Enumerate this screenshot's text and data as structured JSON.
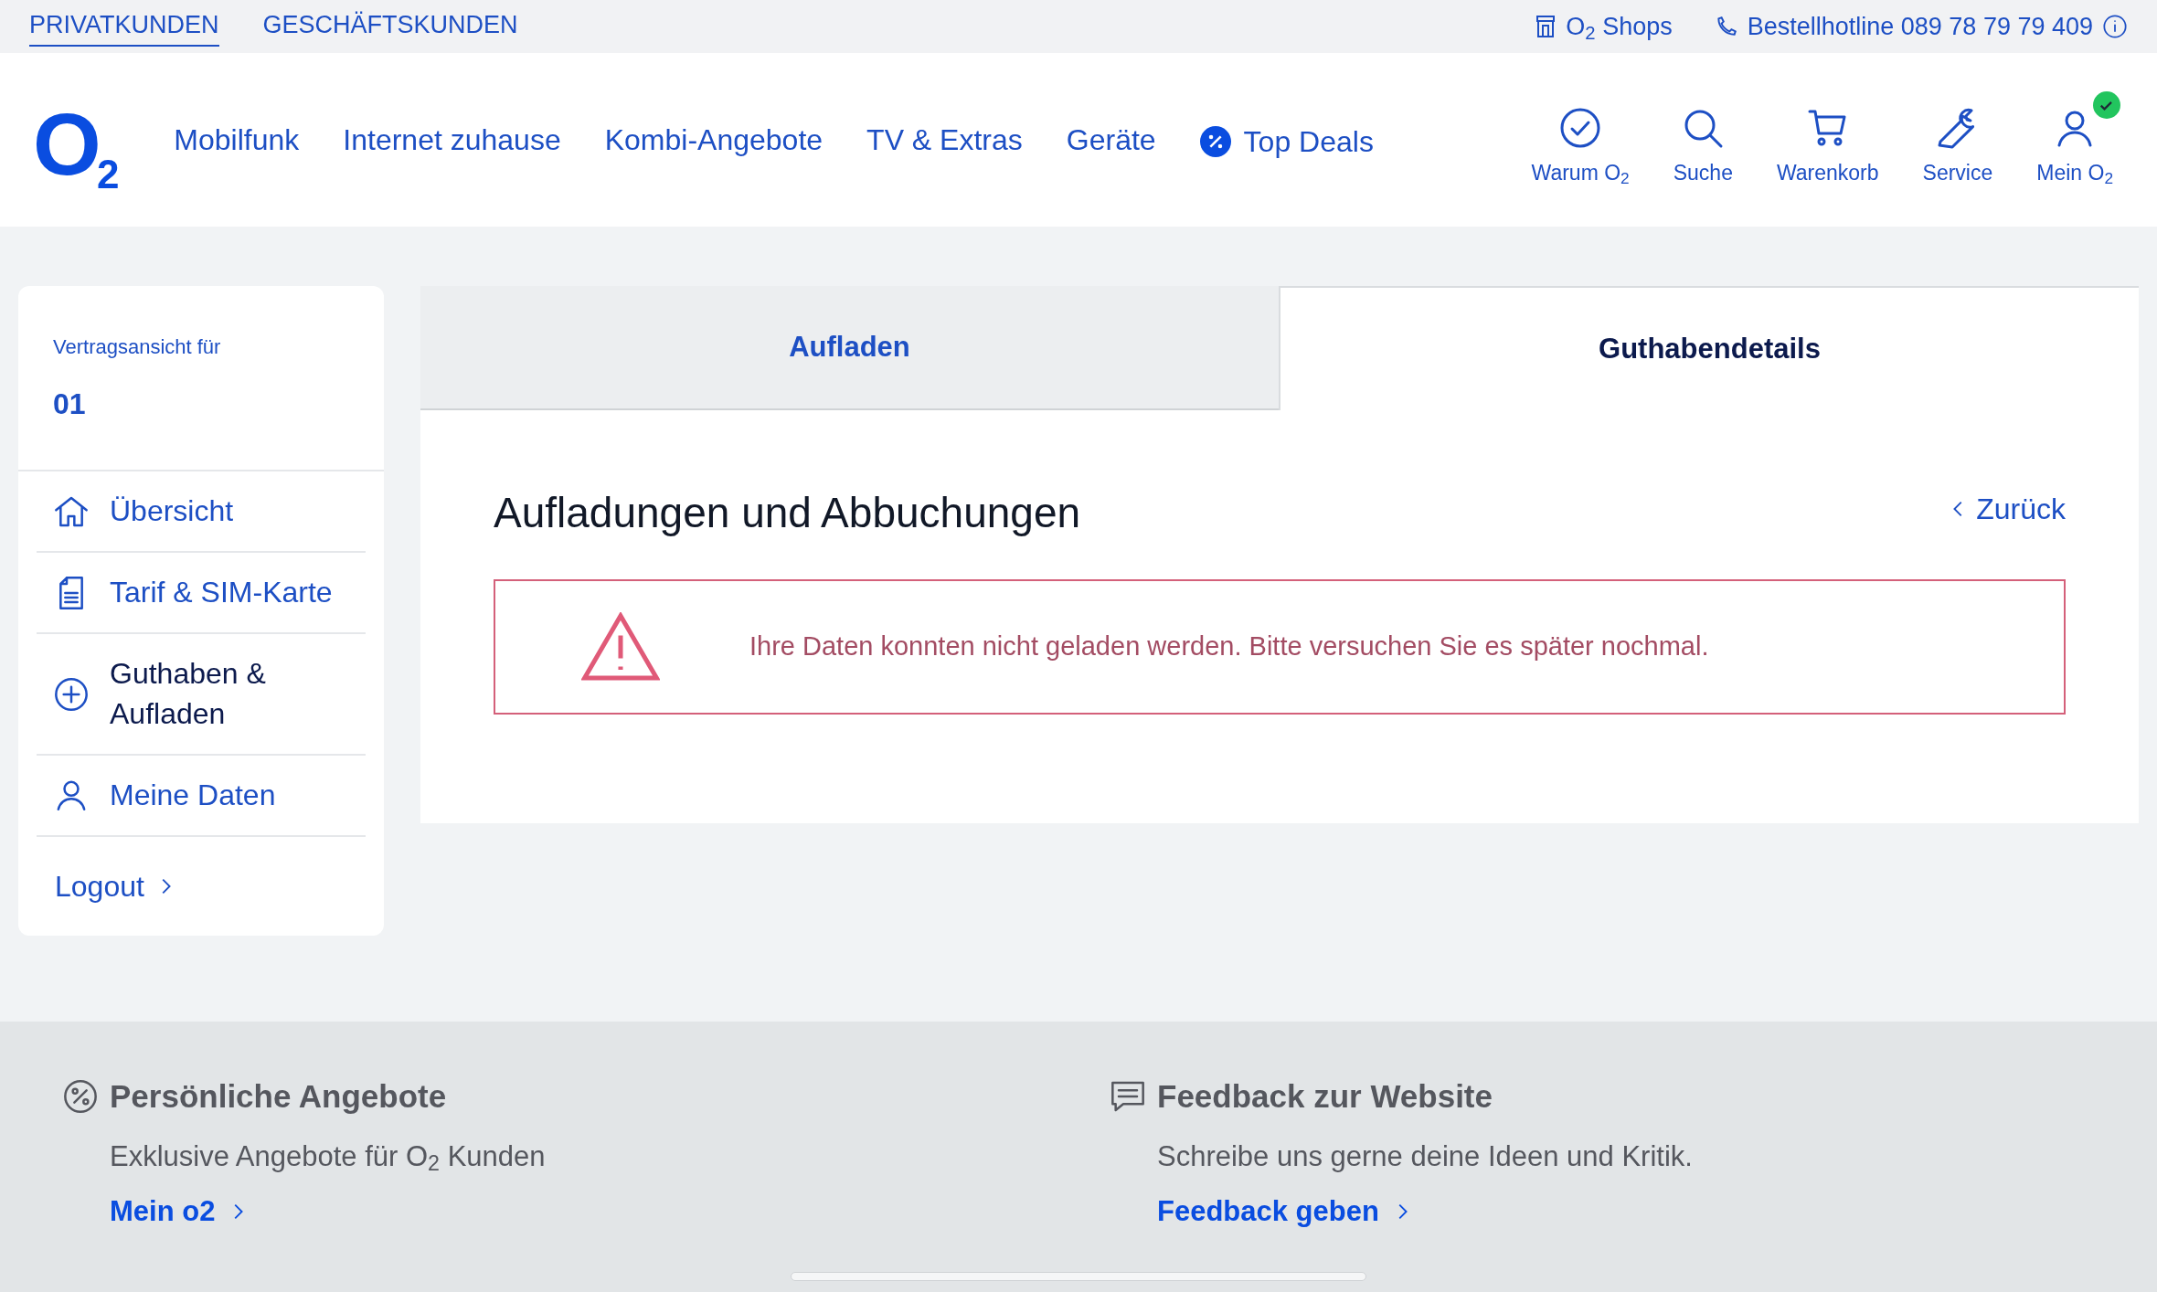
{
  "top_bar": {
    "segments": [
      {
        "label": "PRIVATKUNDEN",
        "selected": true
      },
      {
        "label": "GESCHÄFTSKUNDEN",
        "selected": false
      }
    ],
    "shops": "O$_{2}$ Shops",
    "hotline": "Bestellhotline 089 78 79 79 409"
  },
  "header": {
    "logo": "O",
    "logo_sub": "2",
    "nav": [
      {
        "label": "Mobilfunk",
        "kind": "plain"
      },
      {
        "label": "Internet zuhause",
        "kind": "plain"
      },
      {
        "label": "Kombi-Angebote",
        "kind": "plain"
      },
      {
        "label": "TV & Extras",
        "kind": "plain"
      },
      {
        "label": "Geräte",
        "kind": "plain"
      },
      {
        "label": "Top Deals",
        "kind": "deal"
      }
    ],
    "actions": [
      {
        "label": "Warum O$_{2}$",
        "kind": "check",
        "badge": false
      },
      {
        "label": "Suche",
        "kind": "search",
        "badge": false
      },
      {
        "label": "Warenkorb",
        "kind": "cart",
        "badge": false
      },
      {
        "label": "Service",
        "kind": "wrench",
        "badge": false
      },
      {
        "label": "Mein O$_{2}$",
        "kind": "user",
        "badge": true
      }
    ]
  },
  "sidebar": {
    "caption": "Vertragsansicht für",
    "contract": "01",
    "items": [
      {
        "label": "Übersicht",
        "kind": "home",
        "selected": false
      },
      {
        "label": "Tarif & SIM-Karte",
        "kind": "document",
        "selected": false
      },
      {
        "label": "Guthaben & Aufladen",
        "kind": "plus",
        "selected": true
      },
      {
        "label": "Meine Daten",
        "kind": "user",
        "selected": false
      }
    ],
    "logout": "Logout"
  },
  "tabs": [
    {
      "label": "Aufladen",
      "selected": false
    },
    {
      "label": "Guthabendetails",
      "selected": true
    }
  ],
  "content": {
    "title": "Aufladungen und Abbuchungen",
    "back": "Zurück",
    "error": "Ihre Daten konnten nicht geladen werden. Bitte versuchen Sie es später nochmal."
  },
  "footer": [
    {
      "title": "Persönliche Angebote",
      "kind": "percent",
      "text": "Exklusive Angebote für O$_{2}$ Kunden",
      "link": "Mein o2"
    },
    {
      "title": "Feedback zur Website",
      "kind": "chat",
      "text": "Schreibe uns gerne deine Ideen und Kritik.",
      "link": "Feedback geben"
    }
  ]
}
